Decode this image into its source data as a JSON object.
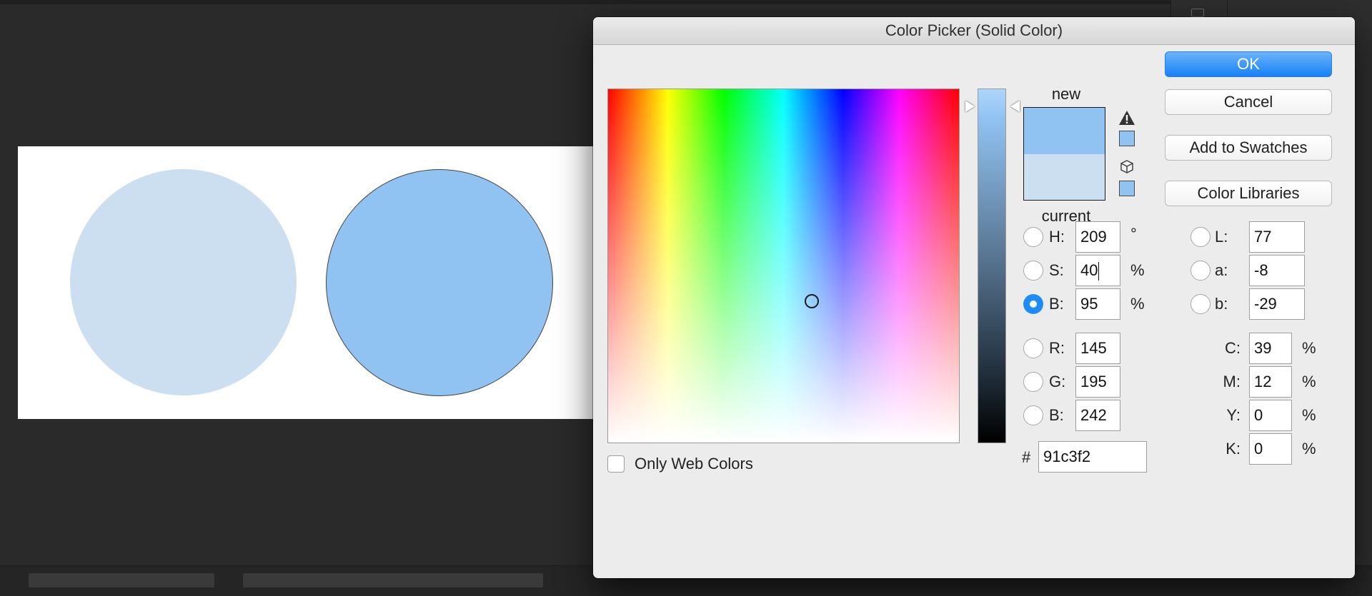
{
  "dialog": {
    "title": "Color Picker (Solid Color)",
    "only_web_colors_label": "Only Web Colors",
    "only_web_colors_checked": false
  },
  "buttons": {
    "ok": "OK",
    "cancel": "Cancel",
    "add_to_swatches": "Add to Swatches",
    "color_libraries": "Color Libraries"
  },
  "preview": {
    "new_label": "new",
    "current_label": "current",
    "new_color": "#91c3f2",
    "current_color": "#cbdff1"
  },
  "fields": {
    "hsb": [
      {
        "label": "H:",
        "value": "209",
        "unit": "°",
        "selected": false
      },
      {
        "label": "S:",
        "value": "40",
        "unit": "%",
        "selected": false
      },
      {
        "label": "B:",
        "value": "95",
        "unit": "%",
        "selected": true
      }
    ],
    "rgb": [
      {
        "label": "R:",
        "value": "145",
        "selected": false
      },
      {
        "label": "G:",
        "value": "195",
        "selected": false
      },
      {
        "label": "B:",
        "value": "242",
        "selected": false
      }
    ],
    "lab": [
      {
        "label": "L:",
        "value": "77",
        "selected": false
      },
      {
        "label": "a:",
        "value": "-8",
        "selected": false
      },
      {
        "label": "b:",
        "value": "-29",
        "selected": false
      }
    ],
    "cmyk": [
      {
        "label": "C:",
        "value": "39",
        "unit": "%"
      },
      {
        "label": "M:",
        "value": "12",
        "unit": "%"
      },
      {
        "label": "Y:",
        "value": "0",
        "unit": "%"
      },
      {
        "label": "K:",
        "value": "0",
        "unit": "%"
      }
    ],
    "hex_label": "#",
    "hex": "91c3f2"
  },
  "selection": {
    "hue_fraction": 0.58,
    "saturation_fraction": 0.4,
    "brightness_fraction": 0.95
  },
  "canvas": {
    "left_circle_color": "#cbdff1",
    "right_circle_color": "#91c3f2"
  },
  "icons": {
    "gamut_warning": "warning-triangle-icon",
    "web_safe": "cube-icon"
  }
}
